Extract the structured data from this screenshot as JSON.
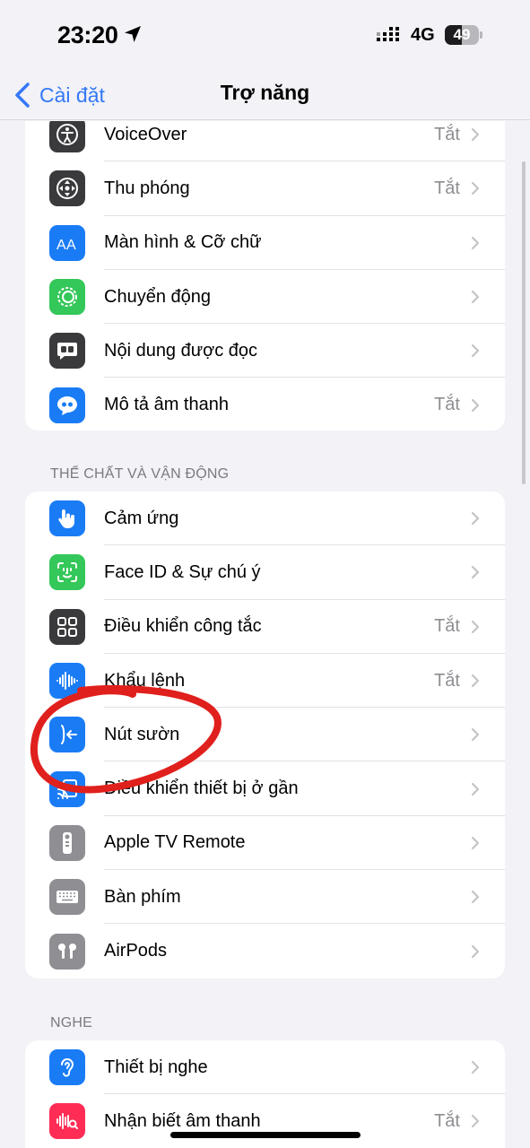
{
  "status_bar": {
    "time": "23:20",
    "network": "4G",
    "battery": "49",
    "battery_percent": 49
  },
  "nav": {
    "back_label": "Cài đặt",
    "title": "Trợ năng"
  },
  "groups": [
    {
      "header": "",
      "rows": [
        {
          "label": "VoiceOver",
          "value": "Tắt",
          "icon": "voiceover-icon",
          "color": "#3a3a3c"
        },
        {
          "label": "Thu phóng",
          "value": "Tắt",
          "icon": "zoom-icon",
          "color": "#3a3a3c"
        },
        {
          "label": "Màn hình & Cỡ chữ",
          "value": "",
          "icon": "text-size-icon",
          "color": "#1a7cf5"
        },
        {
          "label": "Chuyển động",
          "value": "",
          "icon": "motion-icon",
          "color": "#34c759"
        },
        {
          "label": "Nội dung được đọc",
          "value": "",
          "icon": "spoken-content-icon",
          "color": "#3a3a3c"
        },
        {
          "label": "Mô tả âm thanh",
          "value": "Tắt",
          "icon": "audio-description-icon",
          "color": "#1a7cf5"
        }
      ]
    },
    {
      "header": "THỂ CHẤT VÀ VẬN ĐỘNG",
      "rows": [
        {
          "label": "Cảm ứng",
          "value": "",
          "icon": "touch-hand-icon",
          "color": "#1a7cf5"
        },
        {
          "label": "Face ID & Sự chú ý",
          "value": "",
          "icon": "face-id-icon",
          "color": "#34c759"
        },
        {
          "label": "Điều khiển công tắc",
          "value": "Tắt",
          "icon": "switch-control-icon",
          "color": "#3a3a3c"
        },
        {
          "label": "Khẩu lệnh",
          "value": "Tắt",
          "icon": "voice-control-icon",
          "color": "#1a7cf5"
        },
        {
          "label": "Nút sườn",
          "value": "",
          "icon": "side-button-icon",
          "color": "#1a7cf5"
        },
        {
          "label": "Điều khiển thiết bị ở gần",
          "value": "",
          "icon": "nearby-devices-icon",
          "color": "#1a7cf5"
        },
        {
          "label": "Apple TV Remote",
          "value": "",
          "icon": "tv-remote-icon",
          "color": "#8e8e93"
        },
        {
          "label": "Bàn phím",
          "value": "",
          "icon": "keyboard-icon",
          "color": "#8e8e93"
        },
        {
          "label": "AirPods",
          "value": "",
          "icon": "airpods-icon",
          "color": "#8e8e93"
        }
      ]
    },
    {
      "header": "NGHE",
      "rows": [
        {
          "label": "Thiết bị nghe",
          "value": "",
          "icon": "hearing-ear-icon",
          "color": "#1a7cf5"
        },
        {
          "label": "Nhận biết âm thanh",
          "value": "Tắt",
          "icon": "sound-recognition-icon",
          "color": "#ff2d55"
        }
      ]
    }
  ]
}
